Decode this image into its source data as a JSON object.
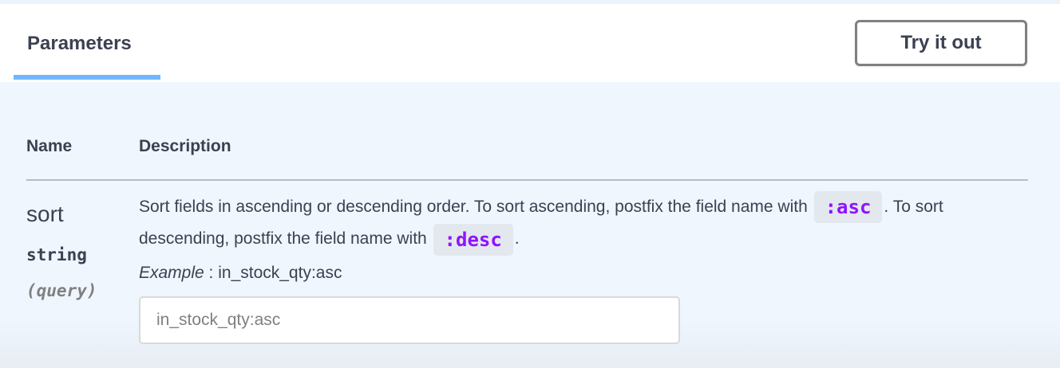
{
  "header": {
    "tab_label": "Parameters",
    "try_button_label": "Try it out"
  },
  "table": {
    "columns": [
      "Name",
      "Description"
    ]
  },
  "parameter": {
    "name": "sort",
    "type": "string",
    "location": "(query)",
    "description": {
      "part1": "Sort fields in ascending or descending order. To sort ascending, postfix the field name with ",
      "code1": ":asc",
      "part2": ". To sort descending, postfix the field name with ",
      "code2": ":desc",
      "part3": "."
    },
    "example_label": "Example",
    "example_separator": " : ",
    "example_value": "in_stock_qty:asc",
    "input_value": "",
    "input_placeholder": "in_stock_qty:asc"
  },
  "colors": {
    "accent": "#61affe",
    "code": "#9012fe",
    "text": "#3b4151",
    "background": "#eff6fe"
  }
}
